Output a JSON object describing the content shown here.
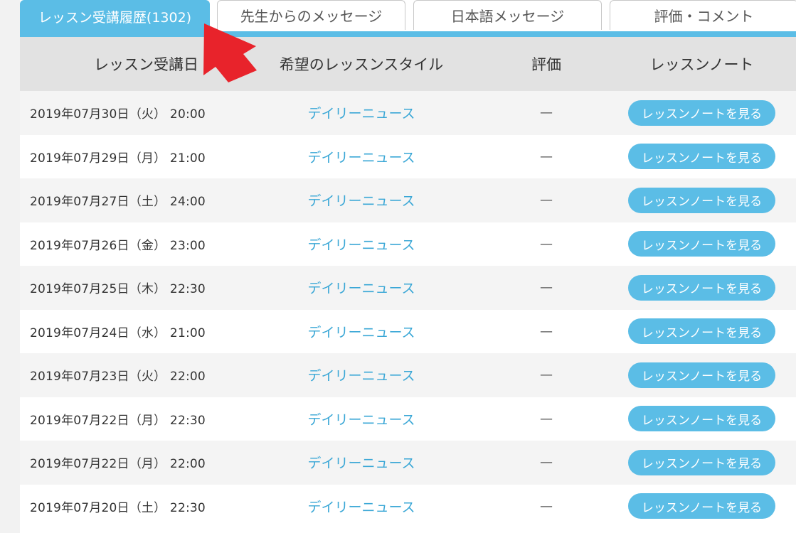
{
  "tabs": [
    {
      "label": "レッスン受講履歴(1302)",
      "active": true
    },
    {
      "label": "先生からのメッセージ",
      "active": false
    },
    {
      "label": "日本語メッセージ",
      "active": false
    },
    {
      "label": "評価・コメント",
      "active": false
    }
  ],
  "table": {
    "headers": {
      "date": "レッスン受講日",
      "style": "希望のレッスンスタイル",
      "rating": "評価",
      "note": "レッスンノート"
    },
    "rows": [
      {
        "date": "2019年07月30日（火） 20:00",
        "style": "デイリーニュース",
        "rating": "—",
        "note_button": "レッスンノートを見る"
      },
      {
        "date": "2019年07月29日（月） 21:00",
        "style": "デイリーニュース",
        "rating": "—",
        "note_button": "レッスンノートを見る"
      },
      {
        "date": "2019年07月27日（土） 24:00",
        "style": "デイリーニュース",
        "rating": "—",
        "note_button": "レッスンノートを見る"
      },
      {
        "date": "2019年07月26日（金） 23:00",
        "style": "デイリーニュース",
        "rating": "—",
        "note_button": "レッスンノートを見る"
      },
      {
        "date": "2019年07月25日（木） 22:30",
        "style": "デイリーニュース",
        "rating": "—",
        "note_button": "レッスンノートを見る"
      },
      {
        "date": "2019年07月24日（水） 21:00",
        "style": "デイリーニュース",
        "rating": "—",
        "note_button": "レッスンノートを見る"
      },
      {
        "date": "2019年07月23日（火） 22:00",
        "style": "デイリーニュース",
        "rating": "—",
        "note_button": "レッスンノートを見る"
      },
      {
        "date": "2019年07月22日（月） 22:30",
        "style": "デイリーニュース",
        "rating": "—",
        "note_button": "レッスンノートを見る"
      },
      {
        "date": "2019年07月22日（月） 22:00",
        "style": "デイリーニュース",
        "rating": "—",
        "note_button": "レッスンノートを見る"
      },
      {
        "date": "2019年07月20日（土） 22:30",
        "style": "デイリーニュース",
        "rating": "—",
        "note_button": "レッスンノートを見る"
      }
    ]
  },
  "colors": {
    "accent": "#5bbde6",
    "link": "#3aa7d6",
    "header_bg": "#e2e2e2",
    "annotation_arrow": "#e8232b"
  },
  "annotation": {
    "icon": "red-arrow-icon"
  }
}
